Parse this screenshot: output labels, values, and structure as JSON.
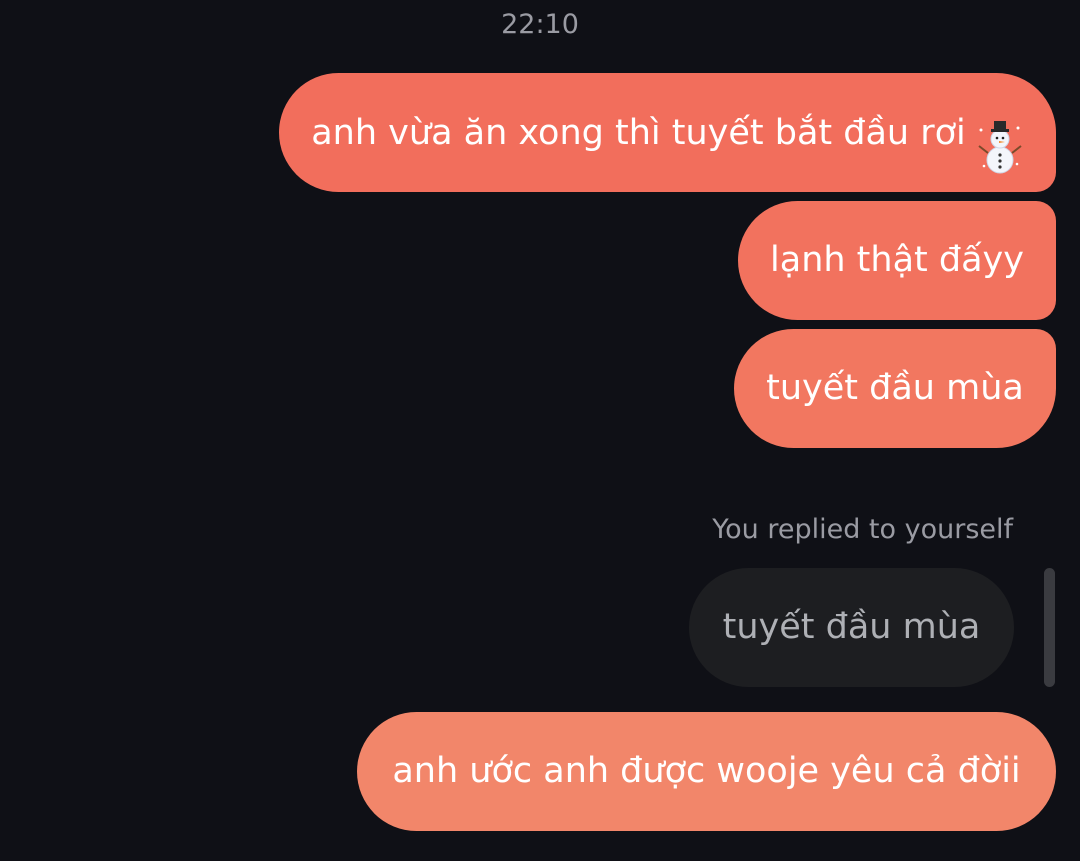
{
  "chat": {
    "timestamp": "22:10",
    "messages": [
      {
        "text": "anh vừa ăn xong thì tuyết bắt đầu rơi",
        "emoji": "snowman-icon"
      },
      {
        "text": "lạnh thật đấyy"
      },
      {
        "text": "tuyết đầu mùa"
      }
    ],
    "reply": {
      "label": "You replied to yourself",
      "quoted_text": "tuyết đầu mùa",
      "message": "anh ước anh được wooje yêu cả đờii"
    }
  },
  "colors": {
    "background": "#0f1016",
    "bubble_top": "#f26e5c",
    "bubble_bottom": "#f2866a",
    "quote_bubble": "#1d1e21",
    "meta_text": "#9a9ba3"
  }
}
